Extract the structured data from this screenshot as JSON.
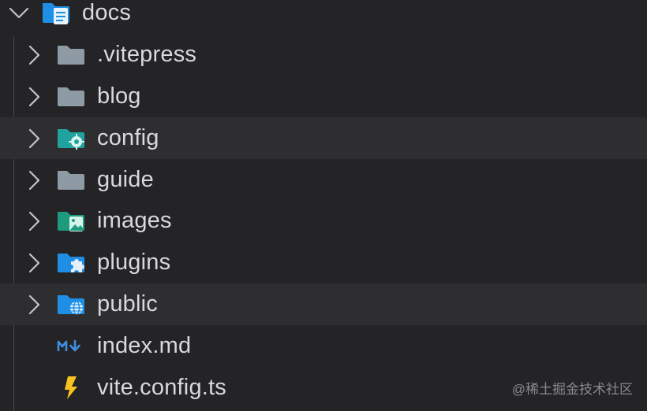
{
  "explorer": {
    "root": {
      "label": "docs",
      "expanded": true,
      "icon": "folder-docs-icon"
    },
    "items": [
      {
        "label": ".vitepress",
        "type": "folder",
        "icon": "folder-icon",
        "collapsed": true
      },
      {
        "label": "blog",
        "type": "folder",
        "icon": "folder-icon",
        "collapsed": true
      },
      {
        "label": "config",
        "type": "folder",
        "icon": "folder-config-icon",
        "collapsed": true,
        "highlighted": true
      },
      {
        "label": "guide",
        "type": "folder",
        "icon": "folder-icon",
        "collapsed": true
      },
      {
        "label": "images",
        "type": "folder",
        "icon": "folder-images-icon",
        "collapsed": true
      },
      {
        "label": "plugins",
        "type": "folder",
        "icon": "folder-plugin-icon",
        "collapsed": true
      },
      {
        "label": "public",
        "type": "folder",
        "icon": "folder-public-icon",
        "collapsed": true,
        "highlighted": true
      },
      {
        "label": "index.md",
        "type": "file",
        "icon": "markdown-icon"
      },
      {
        "label": "vite.config.ts",
        "type": "file",
        "icon": "vite-icon"
      }
    ]
  },
  "watermark": "@稀土掘金技术社区",
  "colors": {
    "background": "#242426",
    "row_highlight": "#2e2e31",
    "text": "#d9d9db",
    "folder_gray": "#8e9aa4",
    "folder_teal": "#20a39e",
    "folder_blue": "#1f8fe5",
    "folder_green": "#1e9b7e",
    "vite_yellow": "#f7c41f"
  }
}
